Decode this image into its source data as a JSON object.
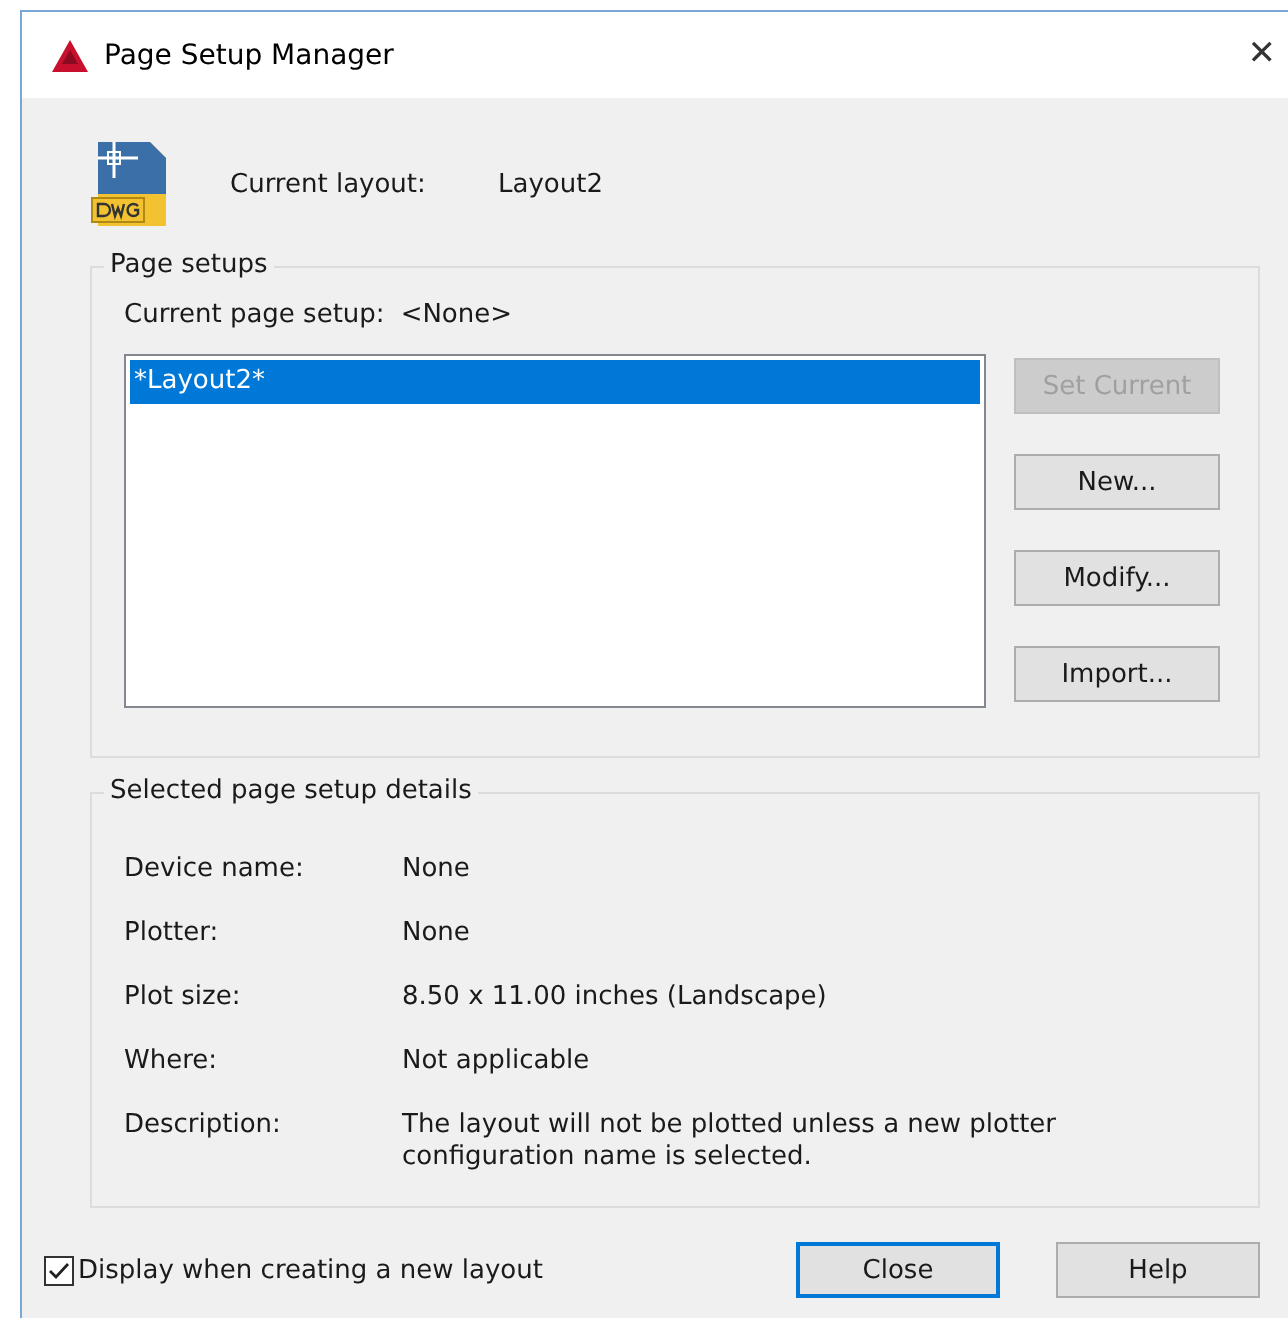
{
  "window": {
    "title": "Page Setup Manager",
    "close_glyph": "✕"
  },
  "current_layout": {
    "label": "Current layout:",
    "value": "Layout2"
  },
  "page_setups": {
    "title": "Page setups",
    "current_label": "Current page setup:",
    "current_value": "<None>",
    "items": [
      {
        "label": "*Layout2*",
        "selected": true
      }
    ],
    "buttons": [
      {
        "label": "Set Current",
        "disabled": true
      },
      {
        "label": "New...",
        "disabled": false
      },
      {
        "label": "Modify...",
        "disabled": false
      },
      {
        "label": "Import...",
        "disabled": false
      }
    ]
  },
  "details": {
    "title": "Selected page setup details",
    "rows": [
      {
        "label": "Device name:",
        "value": "None"
      },
      {
        "label": "Plotter:",
        "value": "None"
      },
      {
        "label": "Plot size:",
        "value": "8.50 x 11.00 inches (Landscape)"
      },
      {
        "label": "Where:",
        "value": "Not applicable"
      },
      {
        "label": "Description:",
        "value": "The layout will not be plotted unless a new plotter configuration name is selected."
      }
    ]
  },
  "display_checkbox": {
    "label": "Display when creating a new layout",
    "checked": true
  },
  "footer_buttons": [
    {
      "label": "Close",
      "default": true
    },
    {
      "label": "Help",
      "default": false
    }
  ]
}
